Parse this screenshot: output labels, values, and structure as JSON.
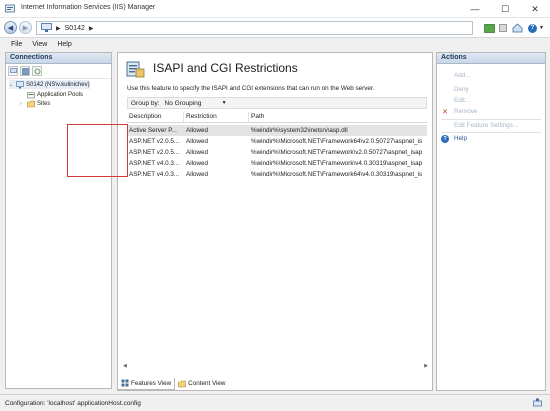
{
  "window": {
    "title": "Internet Information Services (IIS) Manager",
    "minimize_glyph": "—",
    "maximize_glyph": "☐",
    "close_glyph": "✕"
  },
  "address": {
    "crumbs": [
      "S0142"
    ],
    "back_glyph": "◀",
    "forward_glyph": "▶",
    "help_glyph": "?"
  },
  "menu": {
    "items": [
      "File",
      "View",
      "Help"
    ]
  },
  "connections": {
    "title": "Connections",
    "tree": [
      {
        "label": "S0142 (NS\\v.kulinichev)",
        "expander": "⌄",
        "level": 0,
        "icon": "server-icon"
      },
      {
        "label": "Application Pools",
        "expander": "",
        "level": 1,
        "icon": "app-pools-icon"
      },
      {
        "label": "Sites",
        "expander": "›",
        "level": 1,
        "icon": "sites-folder-icon"
      }
    ]
  },
  "feature": {
    "title": "ISAPI and CGI Restrictions",
    "description": "Use this feature to specify the ISAPI and CGI extensions that can run on the Web server.",
    "groupby_label": "Group by:",
    "groupby_value": "No Grouping",
    "columns": [
      "Description",
      "Restriction",
      "Path"
    ],
    "rows": [
      {
        "description": "Active Server P...",
        "restriction": "Allowed",
        "path": "%windir%\\system32\\inetsrv\\asp.dll",
        "selected": true
      },
      {
        "description": "ASP.NET v2.0.5...",
        "restriction": "Allowed",
        "path": "%windir%\\Microsoft.NET\\Framework64\\v2.0.50727\\aspnet_is",
        "selected": false
      },
      {
        "description": "ASP.NET v2.0.5...",
        "restriction": "Allowed",
        "path": "%windir%\\Microsoft.NET\\Framework\\v2.0.50727\\aspnet_isap",
        "selected": false
      },
      {
        "description": "ASP.NET v4.0.3...",
        "restriction": "Allowed",
        "path": "%windir%\\Microsoft.NET\\Framework\\v4.0.30319\\aspnet_isap",
        "selected": false
      },
      {
        "description": "ASP.NET v4.0.3...",
        "restriction": "Allowed",
        "path": "%windir%\\Microsoft.NET\\Framework64\\v4.0.30319\\aspnet_is",
        "selected": false
      }
    ]
  },
  "view_tabs": {
    "features": "Features View",
    "content": "Content View"
  },
  "actions": {
    "title": "Actions",
    "items": [
      {
        "label": "Add...",
        "enabled": false,
        "icon": ""
      },
      {
        "label": "Deny",
        "enabled": false,
        "icon": ""
      },
      {
        "label": "Edit...",
        "enabled": false,
        "icon": ""
      },
      {
        "label": "Remove",
        "enabled": false,
        "icon": "✕"
      },
      {
        "label": "Edit Feature Settings...",
        "enabled": false,
        "icon": ""
      },
      {
        "label": "Help",
        "enabled": true,
        "icon": "?"
      }
    ]
  },
  "status": {
    "text": "Configuration: 'localhost' applicationHost.config"
  },
  "colors": {
    "highlight_border": "#d23a3a",
    "remove_icon": "#c0392b",
    "help_icon": "#2a6ebb"
  }
}
